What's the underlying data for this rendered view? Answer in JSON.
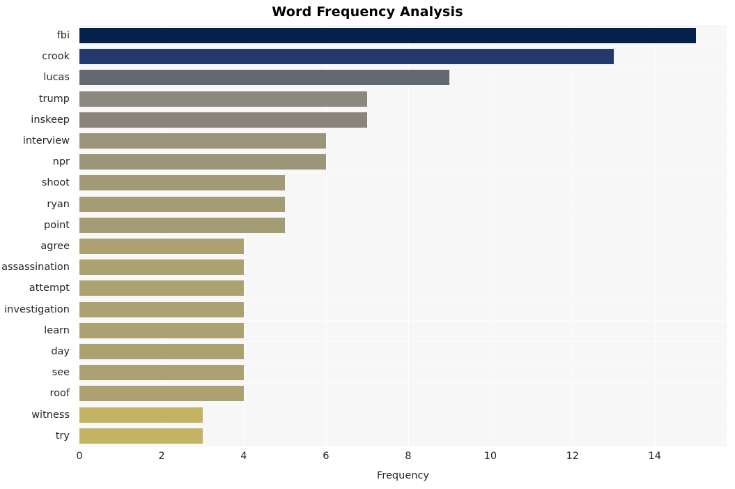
{
  "chart_data": {
    "type": "bar",
    "orientation": "horizontal",
    "title": "Word Frequency Analysis",
    "xlabel": "Frequency",
    "ylabel": "",
    "categories": [
      "fbi",
      "crook",
      "lucas",
      "trump",
      "inskeep",
      "interview",
      "npr",
      "shoot",
      "ryan",
      "point",
      "agree",
      "assassination",
      "attempt",
      "investigation",
      "learn",
      "day",
      "see",
      "roof",
      "witness",
      "try"
    ],
    "values": [
      15,
      13,
      9,
      7,
      7,
      6,
      6,
      5,
      5,
      5,
      4,
      4,
      4,
      4,
      4,
      4,
      4,
      4,
      3,
      3
    ],
    "xlim": [
      0,
      15.75
    ],
    "xticks": [
      0,
      2,
      4,
      6,
      8,
      10,
      12,
      14
    ],
    "xtick_labels": [
      "0",
      "2",
      "4",
      "6",
      "8",
      "10",
      "12",
      "14"
    ],
    "grid": true,
    "legend": false,
    "bar_colors": [
      "#05214a",
      "#24386c",
      "#646873",
      "#8b887e",
      "#89857c",
      "#99947a",
      "#9b9579",
      "#a39b75",
      "#a49c74",
      "#a49c74",
      "#ab a171",
      "#aba171",
      "#aba171",
      "#aba171",
      "#aba171",
      "#aba171",
      "#aba171",
      "#aba171",
      "#c3b463",
      "#c3b463"
    ],
    "plot_background": "#f7f7f7",
    "gridline_color": "#ffffff",
    "text_color": "#262626",
    "title_color": "#000000"
  }
}
